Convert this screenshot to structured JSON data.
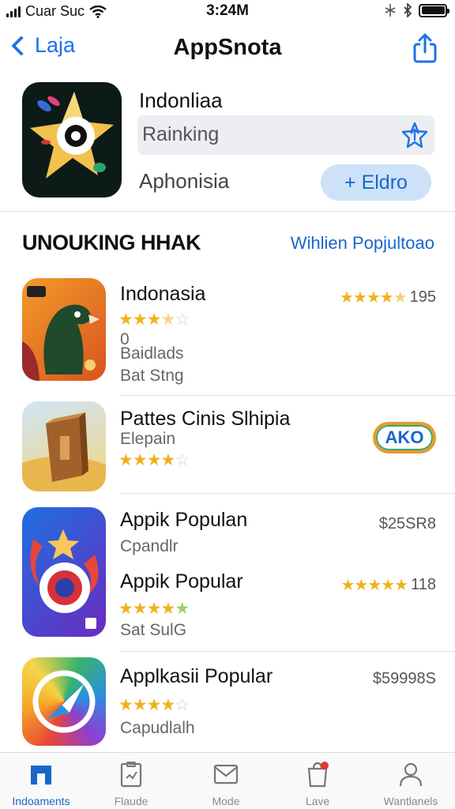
{
  "status_bar": {
    "carrier": "Cuar Suc",
    "time": "3:24M"
  },
  "nav": {
    "back_label": "Laja",
    "title": "AppSnota"
  },
  "hero": {
    "name": "Indonliaa",
    "ranking": "Rainking",
    "category": "Aphonisia",
    "get_label": "+  Eldro"
  },
  "section": {
    "title": "UNOUKING HHAK",
    "link": "Wihlien Popjultoao"
  },
  "apps": [
    {
      "title": "Indonasia",
      "line1": "0",
      "line2": "Baidlads",
      "line3": "Bat Stng",
      "right_text": "195",
      "right_rating": 4.5,
      "rating": 3.5
    },
    {
      "title": "Pattes Cinis Slhipia",
      "sub": "Elepain",
      "badge": "AKO",
      "rating": 4
    },
    {
      "title": "Appik Populan",
      "sub": "Cpandlr",
      "right_text": "$25SR8"
    },
    {
      "title": "Appik Popular",
      "sub": "Sat SulG",
      "right_text": "118",
      "right_rating": 5,
      "rating": 4.5
    },
    {
      "title": "Applkasii Popular",
      "sub": "Capudlalh",
      "right_text": "$59998S",
      "rating": 4
    }
  ],
  "tabs": [
    {
      "label": "Indoaments",
      "icon": "home-icon",
      "active": true
    },
    {
      "label": "Flaude",
      "icon": "clipboard-icon"
    },
    {
      "label": "Mode",
      "icon": "mail-icon"
    },
    {
      "label": "Lave",
      "icon": "bag-icon"
    },
    {
      "label": "Wantlanels",
      "icon": "person-icon"
    }
  ],
  "colors": {
    "accent": "#1a66c9",
    "star": "#f1b11b"
  }
}
